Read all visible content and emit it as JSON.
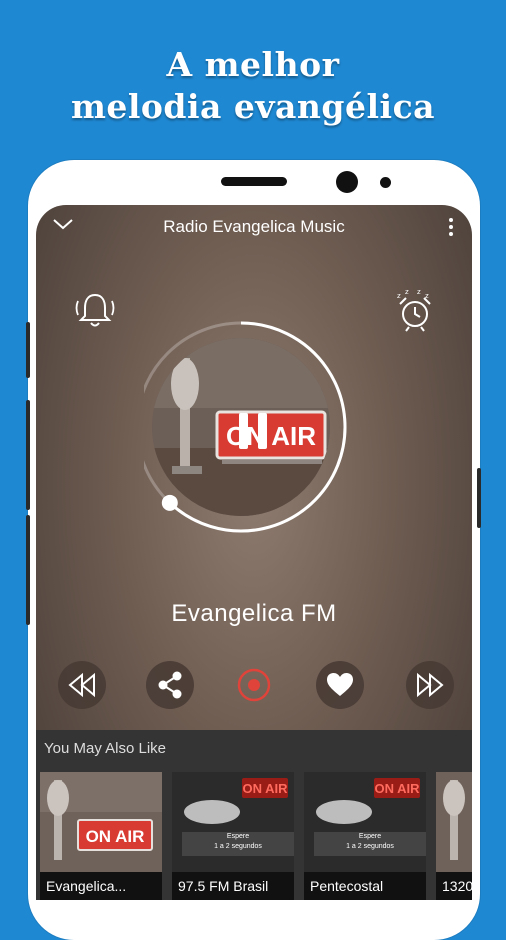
{
  "promo": {
    "line1": "A melhor",
    "line2": "melodia evangélica"
  },
  "app": {
    "title": "Radio Evangelica Music",
    "collapse_icon": "chevron-down-icon",
    "menu_icon": "more-vert-icon",
    "bell_icon": "bell-icon",
    "alarm_icon": "alarm-clock-icon"
  },
  "player": {
    "state": "playing",
    "play_pause_icon": "pause-icon",
    "artwork_text": "ON AIR",
    "station_name": "Evangelica FM",
    "progress_fraction": 0.62
  },
  "controls": [
    {
      "name": "rewind-button",
      "icon": "rewind-icon"
    },
    {
      "name": "share-button",
      "icon": "share-icon"
    },
    {
      "name": "record-button",
      "icon": "record-icon"
    },
    {
      "name": "favorite-button",
      "icon": "heart-icon"
    },
    {
      "name": "fast-forward-button",
      "icon": "fast-forward-icon"
    }
  ],
  "recommendations": {
    "title": "You May Also Like",
    "items": [
      {
        "label": "Evangelica...",
        "art_text": "ON AIR"
      },
      {
        "label": "97.5 FM Brasil",
        "art_text": "ON AIR",
        "caption1": "Espere",
        "caption2": "1 a 2 segundos"
      },
      {
        "label": "Pentecostal",
        "art_text": "ON AIR",
        "caption1": "Espere",
        "caption2": "1 a 2 segundos"
      },
      {
        "label": "1320"
      }
    ]
  },
  "colors": {
    "background": "#1f88d2",
    "record_accent": "#e0433a",
    "section_bg": "#343434"
  }
}
